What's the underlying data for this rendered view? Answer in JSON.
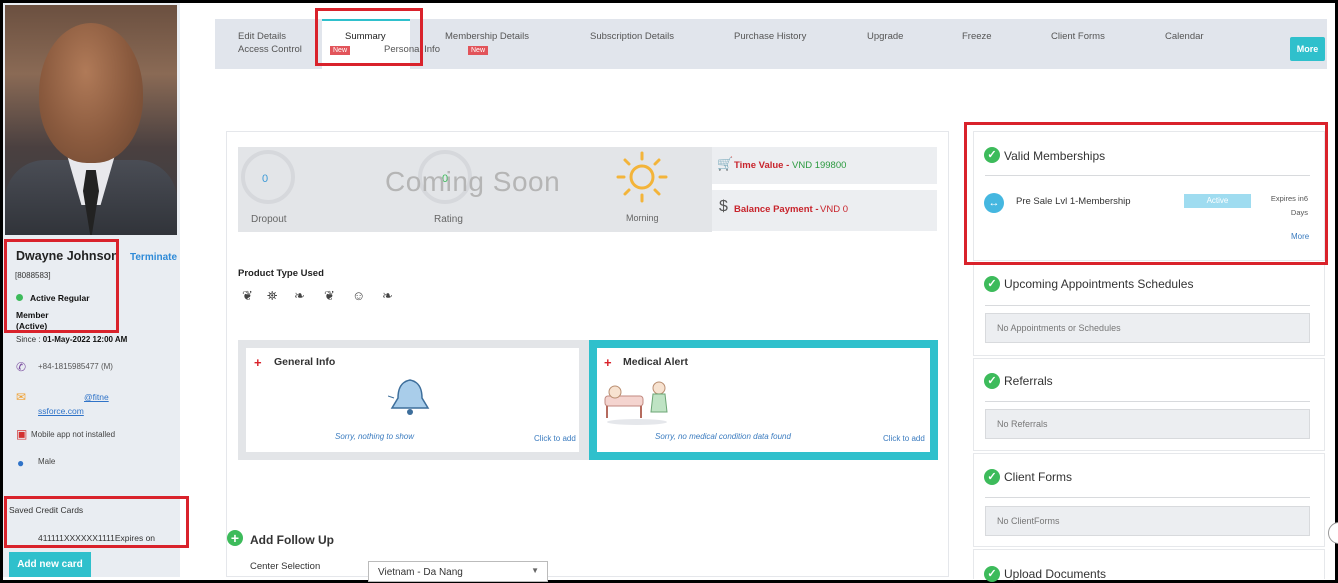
{
  "member": {
    "name": "Dwayne Johnson",
    "terminate_label": "Terminate",
    "id": "[8088583]",
    "status": "Active Regular",
    "type": "Member (Active)",
    "since_label": "Since :",
    "since_value": "01-May-2022 12:00 AM",
    "phone": "+84-1815985477 (M)",
    "email_part1": "@fitne",
    "email_part2": "ssforce.com",
    "mobile_app": "Mobile app not installed",
    "gender": "Male"
  },
  "cards": {
    "title": "Saved Credit Cards",
    "entry": "411111XXXXXX1111Expires on",
    "add_label": "Add new card"
  },
  "tabs": {
    "edit_details": "Edit Details",
    "access_control": "Access Control",
    "summary": "Summary",
    "personal_info": "Personal Info",
    "new_badge": "New",
    "membership_details": "Membership Details",
    "subscription_details": "Subscription Details",
    "purchase_history": "Purchase History",
    "upgrade": "Upgrade",
    "freeze": "Freeze",
    "client_forms": "Client Forms",
    "calendar": "Calendar",
    "more": "More"
  },
  "stats": {
    "dropout_value": "0",
    "dropout_label": "Dropout",
    "rating_value": "0",
    "rating_label": "Rating",
    "coming_soon": "Coming Soon",
    "morning_label": "Morning",
    "time_value_label": "Time Value -",
    "time_value_amount": "VND 199800",
    "balance_label": "Balance Payment -",
    "balance_amount": "VND 0"
  },
  "product": {
    "title": "Product Type Used",
    "icons": [
      "runner-icon",
      "weightlifter-icon",
      "stretch-icon",
      "dancer-icon",
      "yoga-icon",
      "walker-icon"
    ]
  },
  "general_info": {
    "title": "General Info",
    "empty": "Sorry, nothing to show",
    "add": "Click to add"
  },
  "medical_alert": {
    "title": "Medical Alert",
    "empty": "Sorry, no medical condition data found",
    "add": "Click to add"
  },
  "followup": {
    "title": "Add Follow Up",
    "center_label": "Center Selection",
    "center_value": "Vietnam - Da Nang"
  },
  "right": {
    "valid_memberships": "Valid Memberships",
    "membership_name": "Pre Sale Lvl 1-Membership",
    "membership_status": "Active",
    "expires": "Expires in6 Days",
    "more": "More",
    "appointments_title": "Upcoming Appointments Schedules",
    "appointments_empty": "No Appointments or Schedules",
    "referrals_title": "Referrals",
    "referrals_empty": "No Referrals",
    "client_forms_title": "Client Forms",
    "client_forms_empty": "No ClientForms",
    "upload_title": "Upload Documents"
  },
  "colors": {
    "accent": "#2fc0cc",
    "highlight": "#d9222b",
    "success": "#3dbb5b"
  }
}
